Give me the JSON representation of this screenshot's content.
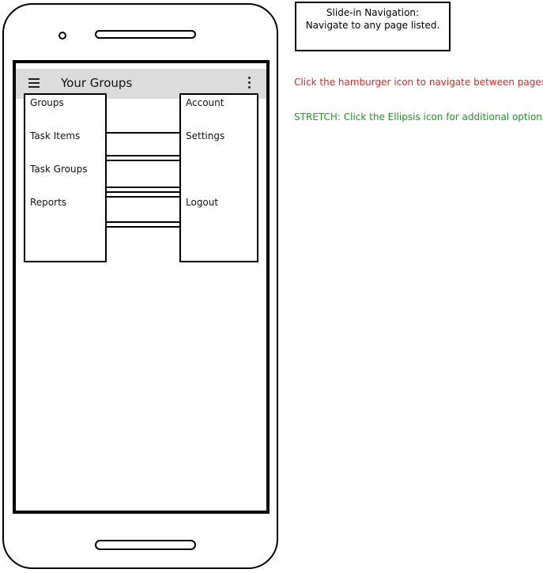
{
  "annotation": {
    "line1": "Slide-in Navigation:",
    "line2": "Navigate to any page listed.",
    "hamburger_note": "Click the hamburger icon to navigate between pages",
    "stretch_note": "STRETCH: Click the Ellipsis icon for additional options"
  },
  "colors": {
    "hamburger_note": "#d42a2a",
    "stretch_note": "#1a9a1a",
    "appbar": "#dcdcdc"
  },
  "appbar": {
    "title": "Your Groups",
    "menu_icon": "hamburger-icon",
    "more_icon": "ellipsis-vertical-icon"
  },
  "nav_left": {
    "items": [
      {
        "label": "Groups"
      },
      {
        "label": "Task Items"
      },
      {
        "label": "Task Groups"
      },
      {
        "label": "Reports"
      }
    ]
  },
  "nav_right": {
    "items": [
      {
        "label": "Account"
      },
      {
        "label": "Settings"
      },
      {
        "label": "Logout"
      }
    ]
  }
}
